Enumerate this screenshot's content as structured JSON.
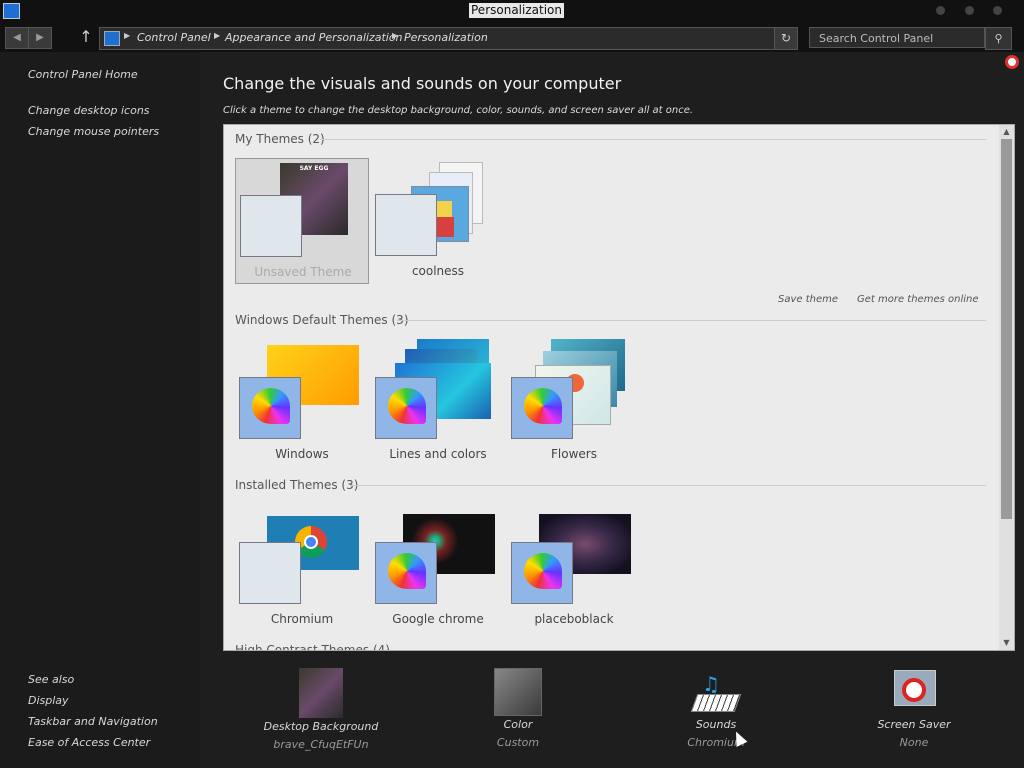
{
  "window": {
    "title": "Personalization"
  },
  "address": {
    "crumbs": [
      "Control Panel",
      "Appearance and Personalization",
      "Personalization"
    ],
    "search_placeholder": "Search Control Panel"
  },
  "sidebar": {
    "home": "Control Panel Home",
    "links": [
      "Change desktop icons",
      "Change mouse pointers"
    ],
    "see_also_title": "See also",
    "see_also": [
      "Display",
      "Taskbar and Navigation",
      "Ease of Access Center"
    ]
  },
  "main": {
    "heading": "Change the visuals and sounds on your computer",
    "subheading": "Click a theme to change the desktop background, color, sounds, and screen saver all at once.",
    "sections": [
      {
        "title": "My Themes (2)",
        "themes": [
          "Unsaved Theme",
          "coolness"
        ]
      },
      {
        "title": "Windows Default Themes (3)",
        "themes": [
          "Windows",
          "Lines and colors",
          "Flowers"
        ]
      },
      {
        "title": "Installed Themes (3)",
        "themes": [
          "Chromium",
          "Google chrome",
          "placeboblack"
        ]
      },
      {
        "title": "High Contrast Themes (4)"
      }
    ],
    "save_theme": "Save theme",
    "get_more": "Get more themes online",
    "wallpaper_caption_title": "SAY EGG"
  },
  "bottom": [
    {
      "label": "Desktop Background",
      "value": "brave_CfuqEtFUn"
    },
    {
      "label": "Color",
      "value": "Custom"
    },
    {
      "label": "Sounds",
      "value": "Chromium"
    },
    {
      "label": "Screen Saver",
      "value": "None"
    }
  ],
  "colors": {
    "accent": "#1f6fd1",
    "panel": "#ebebeb",
    "dark_bg": "#1e1e1e"
  }
}
